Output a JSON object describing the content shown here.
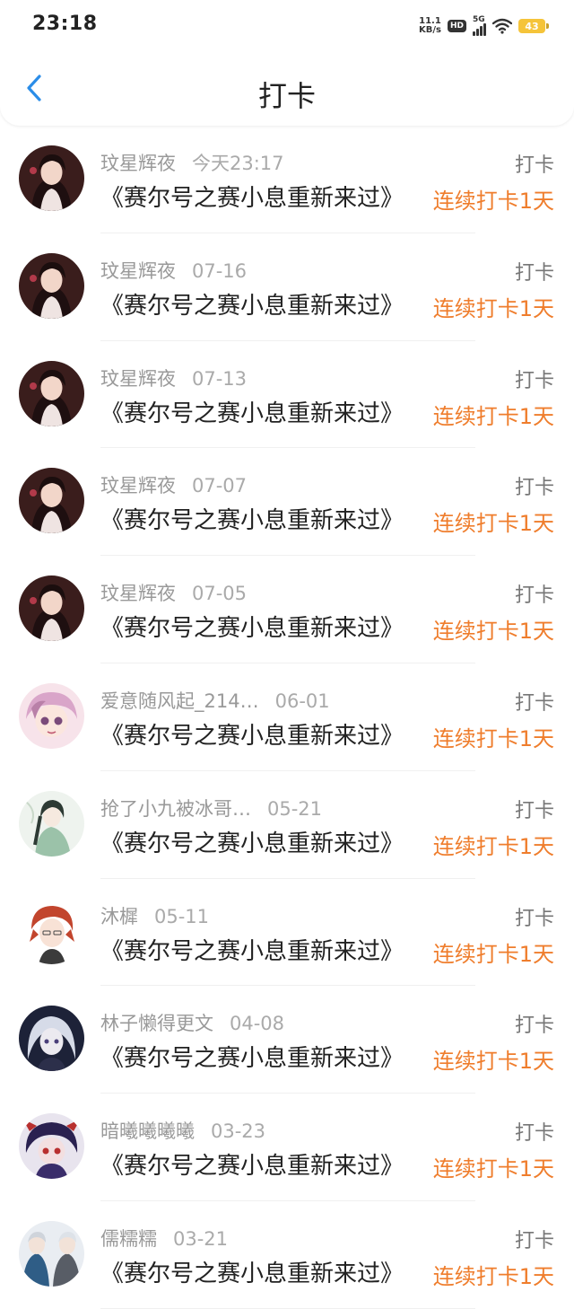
{
  "status_bar": {
    "time": "23:18",
    "net_speed_value": "11.1",
    "net_speed_unit": "KB/s",
    "hd": "HD",
    "network": "5G",
    "battery": "43",
    "battery_color": "#f5c43a"
  },
  "header": {
    "title": "打卡",
    "back_icon": "chevron-left-icon",
    "accent_color": "#2b8de8"
  },
  "streak_color": "#ef7d2c",
  "entries": [
    {
      "user": "玟星辉夜",
      "date": "今天23:17",
      "type": "打卡",
      "book": "《赛尔号之赛小息重新来过》",
      "streak": "连续打卡1天"
    },
    {
      "user": "玟星辉夜",
      "date": "07-16",
      "type": "打卡",
      "book": "《赛尔号之赛小息重新来过》",
      "streak": "连续打卡1天"
    },
    {
      "user": "玟星辉夜",
      "date": "07-13",
      "type": "打卡",
      "book": "《赛尔号之赛小息重新来过》",
      "streak": "连续打卡1天"
    },
    {
      "user": "玟星辉夜",
      "date": "07-07",
      "type": "打卡",
      "book": "《赛尔号之赛小息重新来过》",
      "streak": "连续打卡1天"
    },
    {
      "user": "玟星辉夜",
      "date": "07-05",
      "type": "打卡",
      "book": "《赛尔号之赛小息重新来过》",
      "streak": "连续打卡1天"
    },
    {
      "user": "爱意随风起_214…",
      "date": "06-01",
      "type": "打卡",
      "book": "《赛尔号之赛小息重新来过》",
      "streak": "连续打卡1天"
    },
    {
      "user": "抢了小九被冰哥…",
      "date": "05-21",
      "type": "打卡",
      "book": "《赛尔号之赛小息重新来过》",
      "streak": "连续打卡1天"
    },
    {
      "user": "沐樨",
      "date": "05-11",
      "type": "打卡",
      "book": "《赛尔号之赛小息重新来过》",
      "streak": "连续打卡1天"
    },
    {
      "user": "林子懒得更文",
      "date": "04-08",
      "type": "打卡",
      "book": "《赛尔号之赛小息重新来过》",
      "streak": "连续打卡1天"
    },
    {
      "user": "暗曦曦曦曦",
      "date": "03-23",
      "type": "打卡",
      "book": "《赛尔号之赛小息重新来过》",
      "streak": "连续打卡1天"
    },
    {
      "user": "儒糯糯",
      "date": "03-21",
      "type": "打卡",
      "book": "《赛尔号之赛小息重新来过》",
      "streak": "连续打卡1天"
    }
  ]
}
